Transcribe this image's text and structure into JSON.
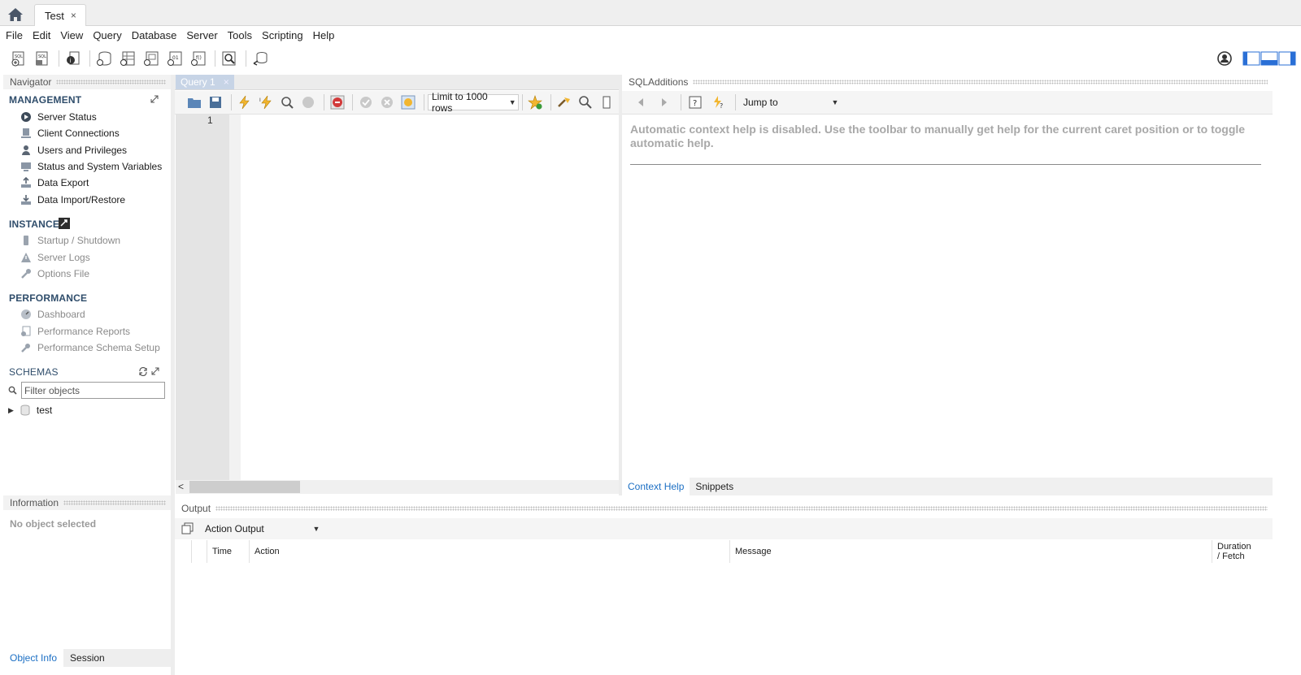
{
  "tabbar": {
    "home_label": "",
    "connection_tab": "Test",
    "close_glyph": "×"
  },
  "menu": [
    "File",
    "Edit",
    "View",
    "Query",
    "Database",
    "Server",
    "Tools",
    "Scripting",
    "Help"
  ],
  "main_toolbar_icons": [
    "new-sql-tab-icon",
    "open-sql-script-icon",
    "inspector-icon",
    "create-schema-icon",
    "create-table-icon",
    "create-view-icon",
    "create-procedure-icon",
    "create-function-icon",
    "search-table-data-icon",
    "reconnect-icon"
  ],
  "navigator": {
    "title": "Navigator",
    "management": {
      "title": "MANAGEMENT",
      "items": [
        "Server Status",
        "Client Connections",
        "Users and Privileges",
        "Status and System Variables",
        "Data Export",
        "Data Import/Restore"
      ]
    },
    "instance": {
      "title": "INSTANCE",
      "items": [
        "Startup / Shutdown",
        "Server Logs",
        "Options File"
      ]
    },
    "performance": {
      "title": "PERFORMANCE",
      "items": [
        "Dashboard",
        "Performance Reports",
        "Performance Schema Setup"
      ]
    },
    "schemas": {
      "title": "SCHEMAS",
      "filter_placeholder": "Filter objects",
      "items": [
        "test"
      ]
    }
  },
  "information": {
    "title": "Information",
    "empty_text": "No object selected",
    "tabs": [
      "Object Info",
      "Session"
    ]
  },
  "query": {
    "tab_label": "Query 1",
    "tab_close": "×",
    "limit_rows": "Limit to 1000 rows",
    "line_numbers": [
      "1"
    ]
  },
  "sql_additions": {
    "title": "SQLAdditions",
    "jump_to": "Jump to",
    "help_text": "Automatic context help is disabled. Use the toolbar to manually get help for the current caret position or to toggle automatic help.",
    "tabs": [
      "Context Help",
      "Snippets"
    ]
  },
  "output": {
    "title": "Output",
    "selector": "Action Output",
    "columns": {
      "time": "Time",
      "action": "Action",
      "message": "Message",
      "duration": "Duration",
      "fetch": "/ Fetch"
    }
  },
  "colors": {
    "link_blue": "#1c6fc4",
    "section_title": "#2f4d6b",
    "query_tab": "#c7d4e6"
  }
}
